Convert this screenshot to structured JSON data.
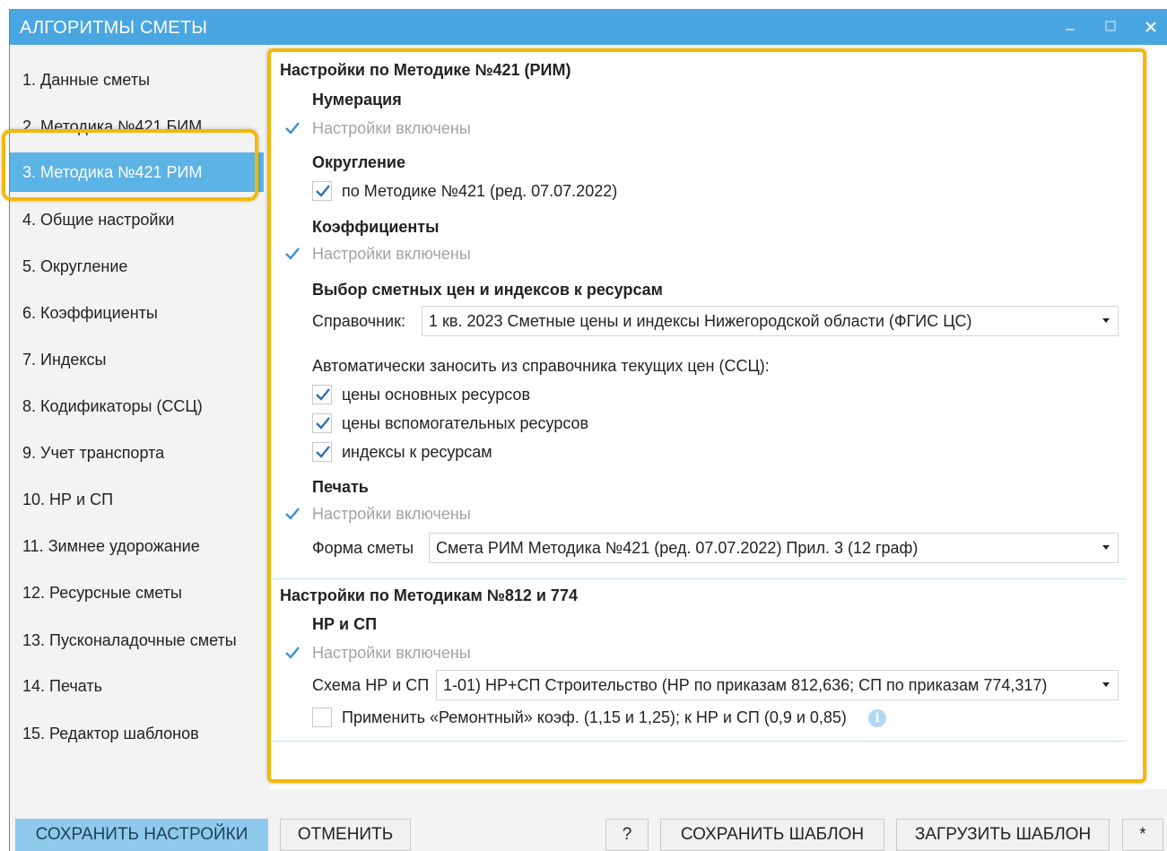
{
  "window": {
    "title": "АЛГОРИТМЫ СМЕТЫ",
    "accent_color": "#4aa6e0",
    "highlight_color": "#f5b800"
  },
  "sidebar": {
    "items": [
      {
        "label": "1. Данные сметы"
      },
      {
        "label": "2. Методика №421 БИМ"
      },
      {
        "label": "3. Методика №421 РИМ",
        "active": true
      },
      {
        "label": "4. Общие настройки"
      },
      {
        "label": "5. Округление"
      },
      {
        "label": "6. Коэффициенты"
      },
      {
        "label": "7. Индексы"
      },
      {
        "label": "8. Кодификаторы (ССЦ)"
      },
      {
        "label": "9. Учет транспорта"
      },
      {
        "label": "10. НР и СП"
      },
      {
        "label": "11. Зимнее удорожание"
      },
      {
        "label": "12. Ресурсные сметы"
      },
      {
        "label": "13. Пусконаладочные сметы"
      },
      {
        "label": "14. Печать"
      },
      {
        "label": "15. Редактор шаблонов"
      }
    ]
  },
  "rim": {
    "title": "Настройки по Методике №421 (РИМ)",
    "numbering": {
      "title": "Нумерация",
      "status": "Настройки включены"
    },
    "rounding": {
      "title": "Округление",
      "option_label": "по Методике №421 (ред. 07.07.2022)",
      "checked": true
    },
    "coefficients": {
      "title": "Коэффициенты",
      "status": "Настройки включены"
    },
    "prices": {
      "title": "Выбор сметных цен и индексов к ресурсам",
      "reference_label": "Справочник:",
      "reference_value": "1 кв. 2023 Сметные цены и индексы Нижегородской области (ФГИС ЦС)",
      "auto_label": "Автоматически заносить из справочника текущих цен (ССЦ):",
      "options": [
        {
          "label": "цены основных ресурсов",
          "checked": true
        },
        {
          "label": "цены вспомогательных ресурсов",
          "checked": true
        },
        {
          "label": "индексы к ресурсам",
          "checked": true
        }
      ]
    },
    "print": {
      "title": "Печать",
      "status": "Настройки включены",
      "form_label": "Форма сметы",
      "form_value": "Смета РИМ Методика №421 (ред. 07.07.2022) Прил. 3 (12 граф)"
    }
  },
  "m812": {
    "title": "Настройки по Методикам №812 и 774",
    "nr_sp": {
      "title": "НР и СП",
      "status": "Настройки включены",
      "scheme_label": "Схема НР и СП",
      "scheme_value": "1-01) НР+СП Строительство (НР по приказам 812,636; СП по приказам 774,317)",
      "repair_label": "Применить «Ремонтный» коэф. (1,15 и 1,25); к НР и СП (0,9 и 0,85)",
      "repair_checked": false
    }
  },
  "buttons": {
    "save_settings": "СОХРАНИТЬ НАСТРОЙКИ",
    "cancel": "ОТМЕНИТЬ",
    "help": "?",
    "save_template": "СОХРАНИТЬ ШАБЛОН",
    "load_template": "ЗАГРУЗИТЬ ШАБЛОН",
    "extra": "*"
  }
}
